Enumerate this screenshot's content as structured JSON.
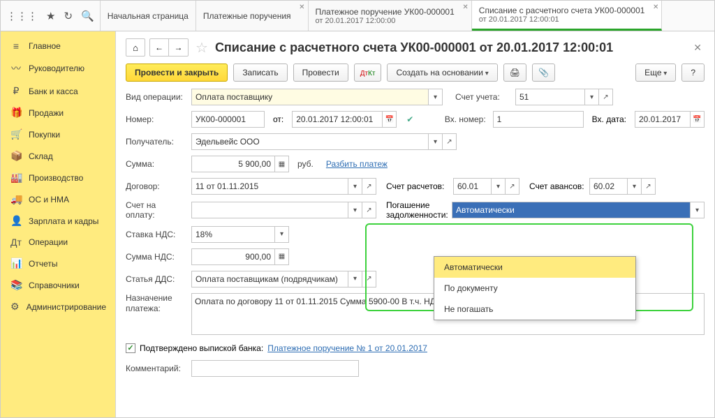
{
  "tabs": [
    {
      "label": "Начальная страница"
    },
    {
      "label": "Платежные поручения"
    },
    {
      "label": "Платежное поручение УК00-000001",
      "sub": "от 20.01.2017 12:00:00"
    },
    {
      "label": "Списание с расчетного счета УК00-000001",
      "sub": "от 20.01.2017 12:00:01"
    }
  ],
  "sidebar": [
    {
      "icon": "≡",
      "label": "Главное"
    },
    {
      "icon": "〰",
      "label": "Руководителю"
    },
    {
      "icon": "₽",
      "label": "Банк и касса"
    },
    {
      "icon": "🎁",
      "label": "Продажи"
    },
    {
      "icon": "🛒",
      "label": "Покупки"
    },
    {
      "icon": "📦",
      "label": "Склад"
    },
    {
      "icon": "🏭",
      "label": "Производство"
    },
    {
      "icon": "🚚",
      "label": "ОС и НМА"
    },
    {
      "icon": "👤",
      "label": "Зарплата и кадры"
    },
    {
      "icon": "Дт",
      "label": "Операции"
    },
    {
      "icon": "📊",
      "label": "Отчеты"
    },
    {
      "icon": "📚",
      "label": "Справочники"
    },
    {
      "icon": "⚙",
      "label": "Администрирование"
    }
  ],
  "page_title": "Списание с расчетного счета УК00-000001 от 20.01.2017 12:00:01",
  "toolbar": {
    "post_close": "Провести и закрыть",
    "save": "Записать",
    "post": "Провести",
    "create_based": "Создать на основании",
    "more": "Еще",
    "help": "?"
  },
  "form": {
    "optype_label": "Вид операции:",
    "optype_value": "Оплата поставщику",
    "account_label": "Счет учета:",
    "account_value": "51",
    "number_label": "Номер:",
    "number_value": "УК00-000001",
    "from_label": "от:",
    "from_value": "20.01.2017 12:00:01",
    "incoming_no_label": "Вх. номер:",
    "incoming_no_value": "1",
    "incoming_date_label": "Вх. дата:",
    "incoming_date_value": "20.01.2017",
    "payee_label": "Получатель:",
    "payee_value": "Эдельвейс ООО",
    "sum_label": "Сумма:",
    "sum_value": "5 900,00",
    "currency": "руб.",
    "split_link": "Разбить платеж",
    "contract_label": "Договор:",
    "contract_value": "11 от 01.11.2015",
    "settle_acc_label": "Счет расчетов:",
    "settle_acc_value": "60.01",
    "advance_acc_label": "Счет авансов:",
    "advance_acc_value": "60.02",
    "invoice_label": "Счет на оплату:",
    "debt_label": "Погашение задолженности:",
    "debt_value": "Автоматически",
    "debt_options": [
      "Автоматически",
      "По документу",
      "Не погашать"
    ],
    "vat_rate_label": "Ставка НДС:",
    "vat_rate_value": "18%",
    "vat_sum_label": "Сумма НДС:",
    "vat_sum_value": "900,00",
    "dds_label": "Статья ДДС:",
    "dds_value": "Оплата поставщикам (подрядчикам)",
    "purpose_label": "Назначение платежа:",
    "purpose_value": "Оплата по договору 11 от 01.11.2015 Сумма 5900-00 В т.ч. НДС  (18%) 900-00",
    "confirmed_label": "Подтверждено выпиской банка:",
    "confirmed_link": "Платежное поручение № 1 от 20.01.2017",
    "comment_label": "Комментарий:"
  }
}
